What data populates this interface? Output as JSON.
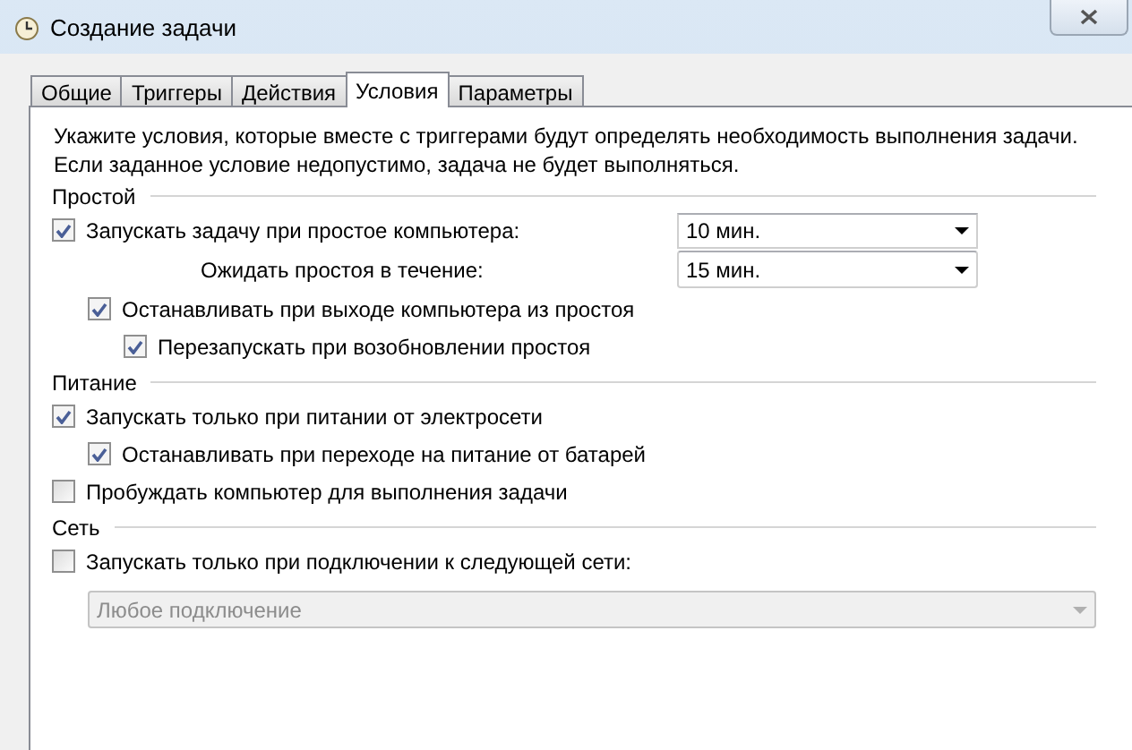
{
  "window": {
    "title": "Создание задачи"
  },
  "tabs": [
    {
      "label": "Общие",
      "selected": false
    },
    {
      "label": "Триггеры",
      "selected": false
    },
    {
      "label": "Действия",
      "selected": false
    },
    {
      "label": "Условия",
      "selected": true
    },
    {
      "label": "Параметры",
      "selected": false
    }
  ],
  "intro": [
    "Укажите условия, которые вместе с триггерами будут определять необходимость выполнения задачи.",
    "Если заданное условие недопустимо, задача не будет выполняться."
  ],
  "sections": [
    {
      "title": "Простой",
      "items": [
        {
          "kind": "checkbox",
          "label": "Запускать задачу при простое компьютера:",
          "checked": true,
          "select": "10 мин.",
          "children": [
            {
              "kind": "select",
              "label": "Ожидать простоя в течение:",
              "value": "15 мин.",
              "disabled": false
            },
            {
              "kind": "checkbox",
              "label": "Останавливать при выходе компьютера из простоя",
              "checked": true,
              "children": [
                {
                  "kind": "checkbox",
                  "label": "Перезапускать при возобновлении простоя",
                  "checked": true
                }
              ]
            }
          ]
        }
      ]
    },
    {
      "title": "Питание",
      "items": [
        {
          "kind": "checkbox",
          "label": "Запускать только при питании от электросети",
          "checked": true,
          "children": [
            {
              "kind": "checkbox",
              "label": "Останавливать при переходе на питание от батарей",
              "checked": true
            }
          ]
        },
        {
          "kind": "checkbox",
          "label": "Пробуждать компьютер для выполнения задачи",
          "checked": false
        }
      ]
    },
    {
      "title": "Сеть",
      "items": [
        {
          "kind": "checkbox",
          "label": "Запускать только при подключении к следующей сети:",
          "checked": false,
          "children": [
            {
              "kind": "select",
              "value": "Любое подключение",
              "disabled": true
            }
          ]
        }
      ]
    }
  ]
}
